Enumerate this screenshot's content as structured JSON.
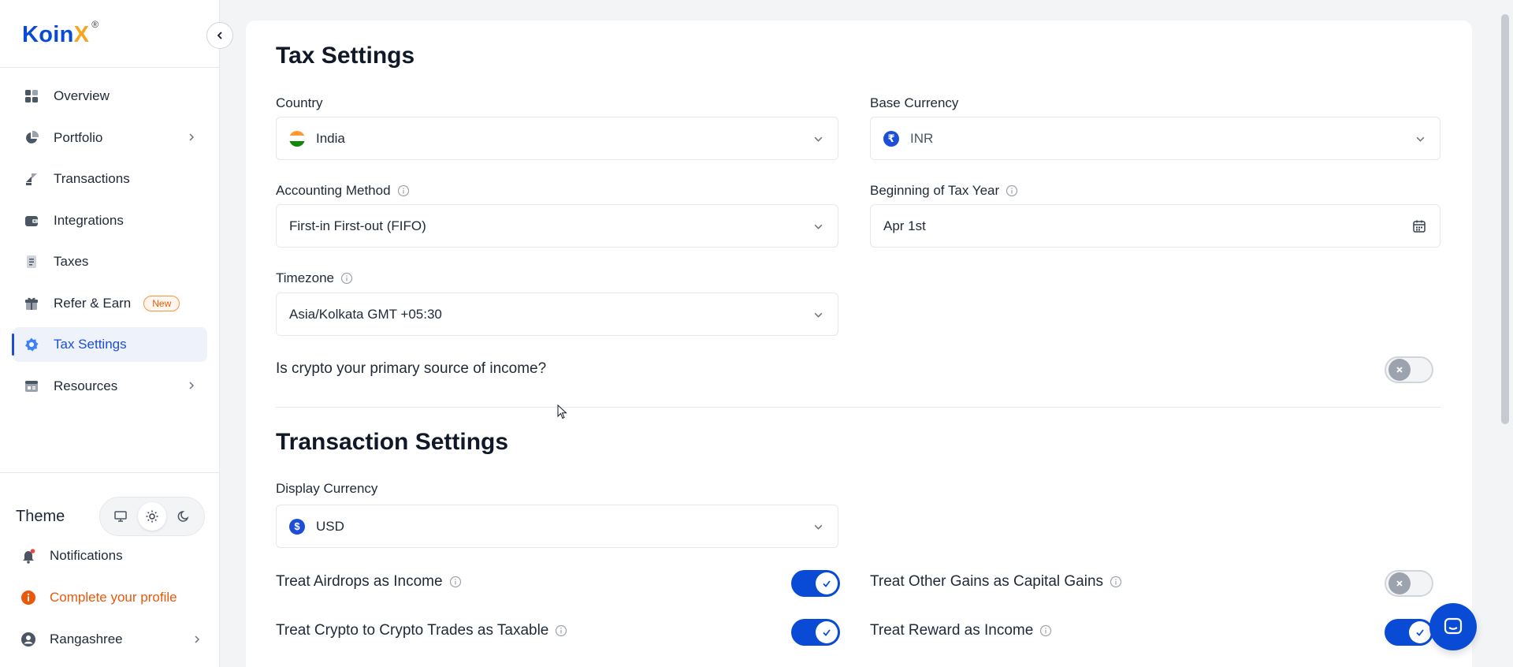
{
  "brand": {
    "name_main": "Koin",
    "name_accent": "X",
    "reg_mark": "®"
  },
  "sidebar": {
    "items": [
      {
        "label": "Overview"
      },
      {
        "label": "Portfolio"
      },
      {
        "label": "Transactions"
      },
      {
        "label": "Integrations"
      },
      {
        "label": "Taxes"
      },
      {
        "label": "Refer & Earn",
        "badge": "New"
      },
      {
        "label": "Tax Settings"
      },
      {
        "label": "Resources"
      }
    ],
    "theme_label": "Theme",
    "notifications_label": "Notifications",
    "complete_profile_label": "Complete your profile",
    "user_name": "Rangashree"
  },
  "tax_settings": {
    "title": "Tax Settings",
    "country": {
      "label": "Country",
      "value": "India"
    },
    "base_currency": {
      "label": "Base Currency",
      "value": "INR",
      "symbol": "₹"
    },
    "accounting_method": {
      "label": "Accounting Method",
      "value": "First-in First-out (FIFO)"
    },
    "tax_year": {
      "label": "Beginning of Tax Year",
      "value": "Apr 1st"
    },
    "timezone": {
      "label": "Timezone",
      "value": "Asia/Kolkata GMT +05:30"
    },
    "primary_income": {
      "label": "Is crypto your primary source of income?",
      "enabled": false
    }
  },
  "transaction_settings": {
    "title": "Transaction Settings",
    "display_currency": {
      "label": "Display Currency",
      "value": "USD",
      "symbol": "$"
    },
    "options": [
      {
        "label": "Treat Airdrops as Income",
        "enabled": true
      },
      {
        "label": "Treat Other Gains as Capital Gains",
        "enabled": false
      },
      {
        "label": "Treat Crypto to Crypto Trades as Taxable",
        "enabled": true
      },
      {
        "label": "Treat Reward as Income",
        "enabled": true
      }
    ]
  },
  "colors": {
    "primary": "#0a4bd6",
    "accent": "#f5a623",
    "warning": "#ea580c"
  }
}
